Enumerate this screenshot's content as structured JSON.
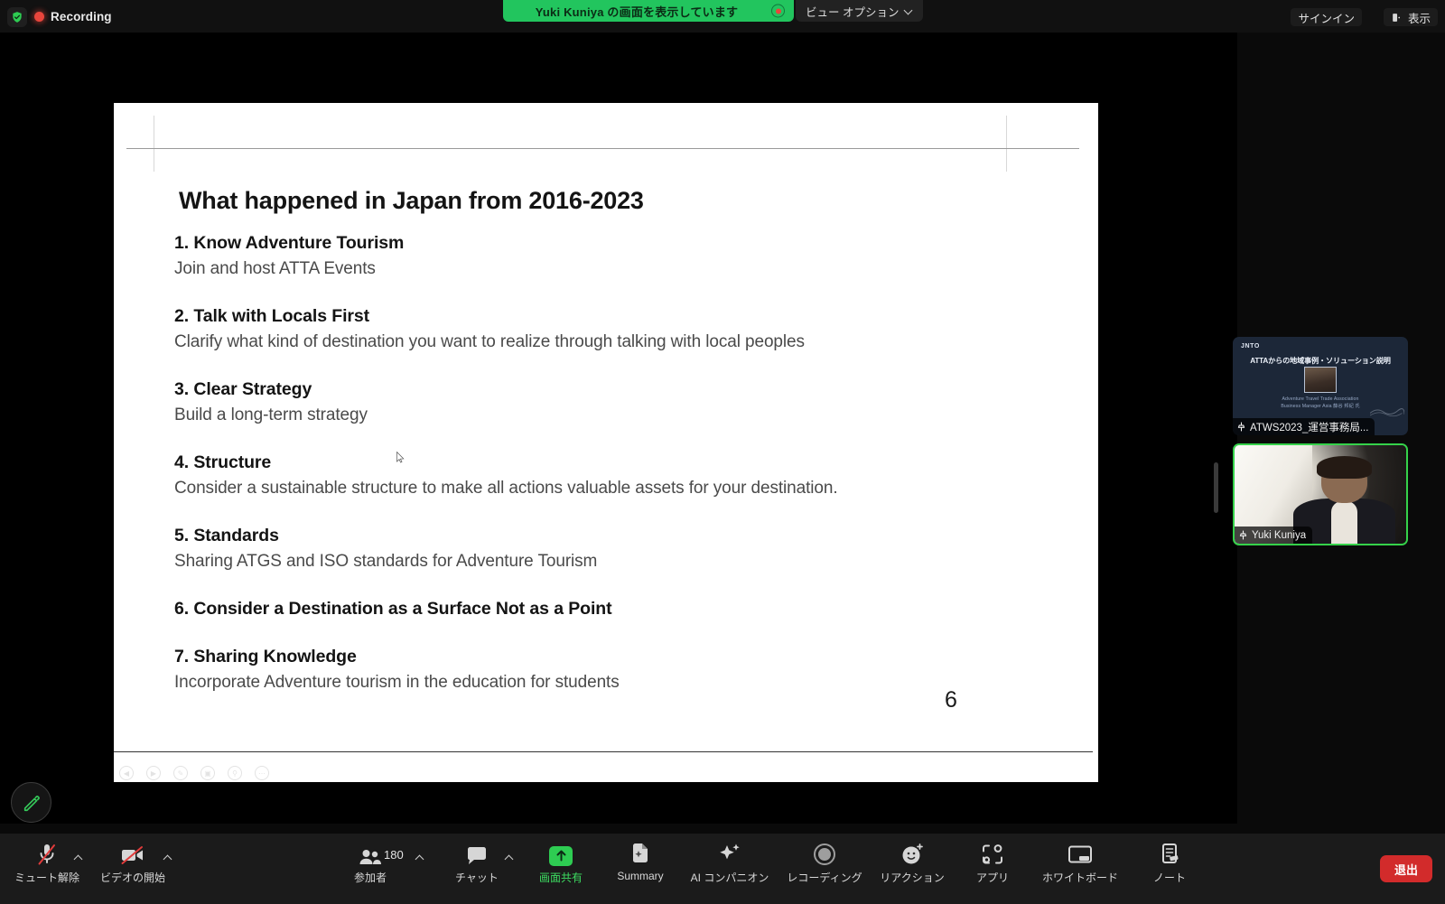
{
  "topbar": {
    "shield_icon": "verified-shield-icon",
    "recording_label": "Recording",
    "share_banner": "Yuki Kuniya の画面を表示しています",
    "view_options_label": "ビュー オプション",
    "signin_label": "サインイン",
    "display_label": "表示"
  },
  "slide": {
    "title": "What happened in Japan from 2016-2023",
    "page_number": "6",
    "items": [
      {
        "heading": "1. Know Adventure Tourism",
        "body": "Join and host ATTA Events"
      },
      {
        "heading": "2. Talk with Locals First",
        "body": "Clarify what kind of destination you want to realize through talking with local peoples"
      },
      {
        "heading": "3. Clear Strategy",
        "body": "Build a long-term strategy"
      },
      {
        "heading": "4. Structure",
        "body": "Consider a sustainable structure to make all actions valuable assets for your destination."
      },
      {
        "heading": "5. Standards",
        "body": "Sharing ATGS and ISO standards for Adventure Tourism"
      },
      {
        "heading": "6. Consider a Destination as a Surface Not as a Point",
        "body": ""
      },
      {
        "heading": "7. Sharing Knowledge",
        "body": "Incorporate Adventure tourism in the education for students"
      }
    ]
  },
  "filmstrip": {
    "tiles": [
      {
        "name": "ATWS2023_運営事務局...",
        "deck_logo": "JNTO",
        "deck_title": "ATTAからの地域事例・ソリューション説明",
        "deck_subtitle": "Adventure Travel Trade Association\nBusiness Manager Asia 藤谷 邦紀 氏"
      },
      {
        "name": "Yuki Kuniya"
      }
    ]
  },
  "toolbar": {
    "items": [
      {
        "label": "ミュート解除",
        "icon": "microphone-muted-icon",
        "active": false,
        "caret": true
      },
      {
        "label": "ビデオの開始",
        "icon": "video-off-icon",
        "active": false,
        "caret": true
      },
      {
        "label": "参加者",
        "icon": "participants-icon",
        "active": false,
        "caret": true,
        "badge": "180"
      },
      {
        "label": "チャット",
        "icon": "chat-icon",
        "active": false,
        "caret": true
      },
      {
        "label": "画面共有",
        "icon": "share-screen-icon",
        "active": true,
        "caret": false
      },
      {
        "label": "Summary",
        "icon": "summary-doc-icon",
        "active": false,
        "caret": false
      },
      {
        "label": "AI コンパニオン",
        "icon": "ai-sparkle-icon",
        "active": false,
        "caret": false
      },
      {
        "label": "レコーディング",
        "icon": "record-circle-icon",
        "active": false,
        "caret": false
      },
      {
        "label": "リアクション",
        "icon": "reactions-smiley-icon",
        "active": false,
        "caret": false
      },
      {
        "label": "アプリ",
        "icon": "apps-icon",
        "active": false,
        "caret": false
      },
      {
        "label": "ホワイトボード",
        "icon": "whiteboard-icon",
        "active": false,
        "caret": false
      },
      {
        "label": "ノート",
        "icon": "notes-icon",
        "active": false,
        "caret": false
      }
    ],
    "leave_label": "退出",
    "annotate_icon": "pencil-annotate-icon"
  },
  "colors": {
    "accent_green": "#22c55e",
    "recording_red": "#e8453c",
    "leave_red": "#d22b2b",
    "active_speaker_border": "#35d24a",
    "toolbar_bg": "#1b1b1b"
  }
}
